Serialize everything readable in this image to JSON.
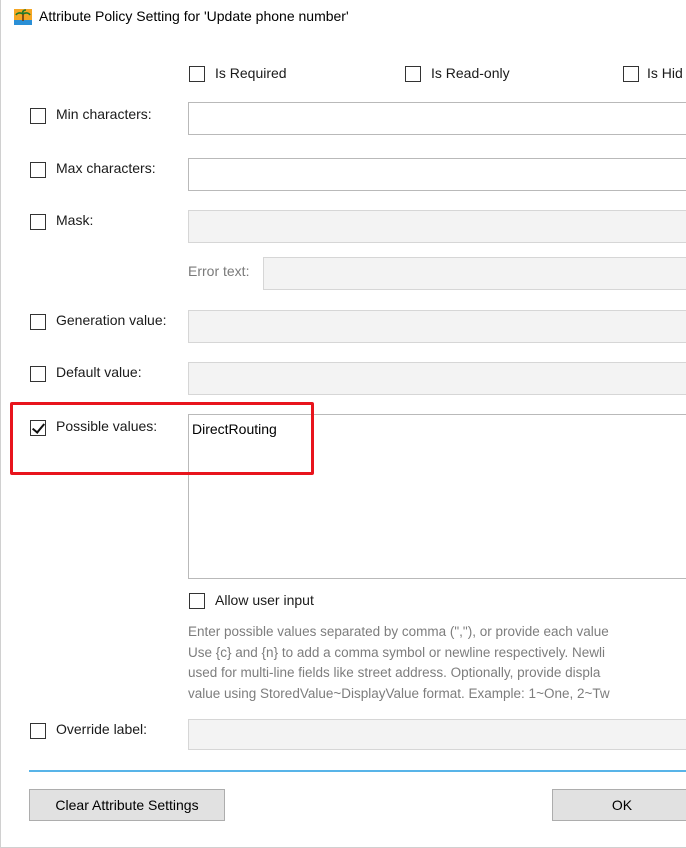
{
  "window": {
    "title": "Attribute Policy Setting for 'Update phone number'"
  },
  "top_options": [
    {
      "label": "Is Required",
      "checked": false
    },
    {
      "label": "Is Read-only",
      "checked": false
    },
    {
      "label": "Is Hid",
      "checked": false
    }
  ],
  "rows": {
    "min_characters": {
      "label": "Min characters:",
      "checked": false,
      "value": ""
    },
    "max_characters": {
      "label": "Max characters:",
      "checked": false,
      "value": ""
    },
    "mask": {
      "label": "Mask:",
      "checked": false,
      "value": "",
      "error_text_label": "Error text:",
      "error_text_value": ""
    },
    "generation_value": {
      "label": "Generation value:",
      "checked": false,
      "value": ""
    },
    "default_value": {
      "label": "Default value:",
      "checked": false,
      "value": ""
    },
    "possible_values": {
      "label": "Possible values:",
      "checked": true,
      "value": "DirectRouting"
    },
    "override_label": {
      "label": "Override label:",
      "checked": false,
      "value": ""
    }
  },
  "allow_user_input": {
    "label": "Allow user input",
    "checked": false
  },
  "help_text": [
    "Enter possible values separated by comma (\",\"), or provide each value",
    "Use {c} and {n} to add a comma symbol or newline respectively. Newli",
    "used for multi-line fields like street address. Optionally, provide displa",
    "value using StoredValue~DisplayValue format. Example: 1~One, 2~Tw"
  ],
  "buttons": {
    "clear": "Clear Attribute Settings",
    "ok": "OK"
  },
  "colors": {
    "highlight": "#e8141c",
    "divider": "#58b4e8"
  }
}
